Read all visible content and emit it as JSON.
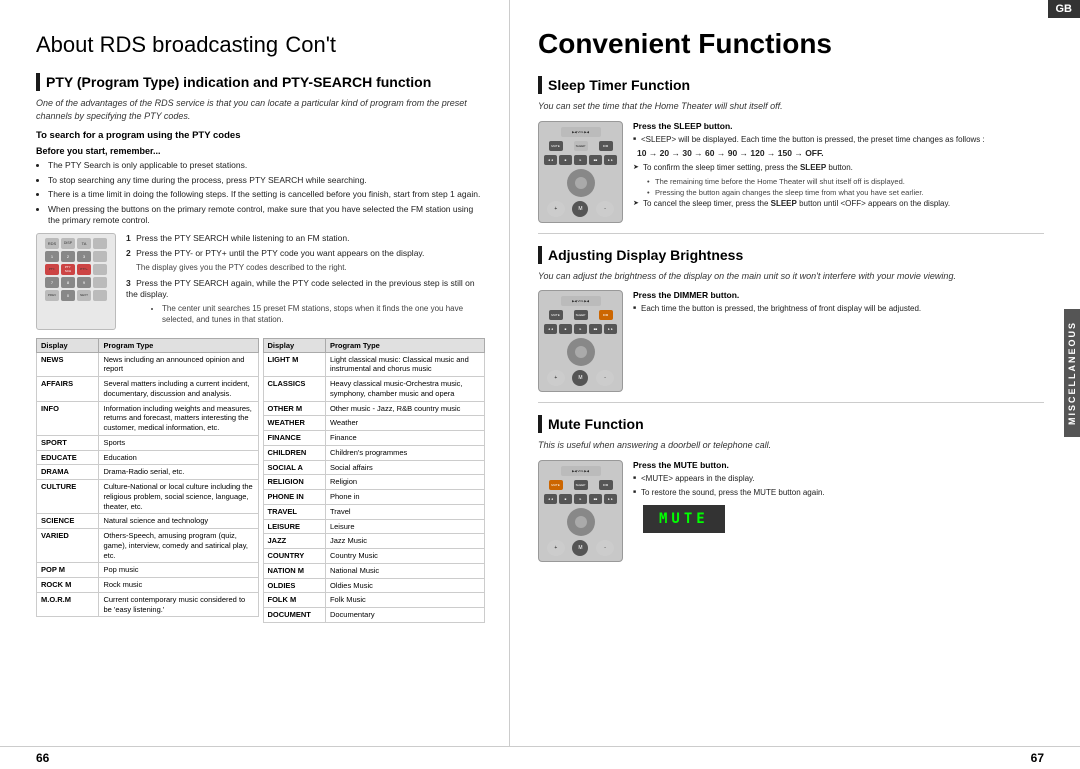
{
  "left": {
    "title": "About RDS broadcasting",
    "title_cont": "Con't",
    "section1_title": "PTY (Program Type) indication and PTY-SEARCH function",
    "intro": "One of the advantages of the RDS service is that you can locate a particular kind of program from the preset channels by specifying the PTY codes.",
    "subheading1": "To search for a program using the PTY codes",
    "subheading2": "Before you start, remember...",
    "bullets": [
      "The PTY Search is only applicable to preset stations.",
      "To stop searching any time during the process, press PTY SEARCH while searching.",
      "There is a time limit in doing the following steps. If the setting is cancelled before you finish, start from step 1 again.",
      "When pressing the buttons on the primary remote control, make sure that you have selected the FM station using the primary remote control."
    ],
    "steps": [
      {
        "num": "1",
        "text": "Press the PTY SEARCH while listening to an FM station."
      },
      {
        "num": "2",
        "text": "Press the PTY- or PTY+ until the PTY code you want appears on the display.",
        "sub": "The display gives you the PTY codes described to the right."
      },
      {
        "num": "3",
        "text": "Press the PTY SEARCH again, while the PTY code selected in the previous step is still on the display.",
        "sub": "The center unit searches 15 preset FM stations, stops when it finds the one you have selected, and tunes in that station."
      }
    ],
    "table_headers": [
      "Display",
      "Program Type",
      "Display",
      "Program Type"
    ],
    "table_rows_left": [
      [
        "NEWS",
        "News including an announced opinion and report"
      ],
      [
        "AFFAIRS",
        "Several matters including a current incident, documentary, discussion and analysis."
      ],
      [
        "INFO",
        "Information including weights and measures, returns and forecast, matters interesting the customer, medical information, etc."
      ],
      [
        "SPORT",
        "Sports"
      ],
      [
        "EDUCATE",
        "Education"
      ],
      [
        "DRAMA",
        "Drama-Radio serial, etc."
      ],
      [
        "CULTURE",
        "Culture-National or local culture including the religious problem, social science, language, theater, etc."
      ],
      [
        "SCIENCE",
        "Natural science and technology"
      ],
      [
        "VARIED",
        "Others-Speech, amusing program (quiz, game), interview, comedy and satirical play, etc."
      ],
      [
        "POP M",
        "Pop music"
      ],
      [
        "ROCK M",
        "Rock music"
      ],
      [
        "M.O.R.M",
        "Current contemporary music considered to be 'easy listening.'"
      ]
    ],
    "table_rows_right": [
      [
        "LIGHT M",
        "Light classical music: Classical music and instrumental and chorus music"
      ],
      [
        "CLASSICS",
        "Heavy classical music-Orchestra music, symphony, chamber music and opera"
      ],
      [
        "OTHER M",
        "Other music - Jazz, R&B country music"
      ],
      [
        "WEATHER",
        "Weather"
      ],
      [
        "FINANCE",
        "Finance"
      ],
      [
        "CHILDREN",
        "Children's programmes"
      ],
      [
        "SOCIAL A",
        "Social affairs"
      ],
      [
        "RELIGION",
        "Religion"
      ],
      [
        "PHONE IN",
        "Phone in"
      ],
      [
        "TRAVEL",
        "Travel"
      ],
      [
        "LEISURE",
        "Leisure"
      ],
      [
        "JAZZ",
        "Jazz Music"
      ],
      [
        "COUNTRY",
        "Country Music"
      ],
      [
        "NATION M",
        "National Music"
      ],
      [
        "OLDIES",
        "Oldies Music"
      ],
      [
        "FOLK M",
        "Folk Music"
      ],
      [
        "DOCUMENT",
        "Documentary"
      ]
    ],
    "page_num": "66"
  },
  "right": {
    "title": "Convenient Functions",
    "gb_badge": "GB",
    "section1_title": "Sleep Timer Function",
    "section1_intro": "You can set the time that the Home Theater will shut itself off.",
    "sleep_press": "Press the SLEEP button.",
    "sleep_bullets": [
      "<SLEEP> will be displayed. Each time the button is pressed, the preset time changes as follows :",
      "10 → 20 → 30 → 60 → 90 → 120 → 150 → OFF."
    ],
    "sleep_confirm": "To confirm the sleep timer setting, press the SLEEP button.",
    "sleep_confirm_subs": [
      "The remaining time before the Home Theater will shut itself off is displayed.",
      "Pressing the button again changes the sleep time from what you have set earlier."
    ],
    "sleep_cancel": "To cancel the sleep timer, press the SLEEP button until <OFF> appears on the display.",
    "section2_title": "Adjusting Display Brightness",
    "section2_intro": "You can adjust the brightness of the display on the main unit so it won't interfere with your movie viewing.",
    "dimmer_press": "Press the DIMMER button.",
    "dimmer_bullet": "Each time the button is pressed, the brightness of front display will be adjusted.",
    "section3_title": "Mute Function",
    "section3_intro": "This is useful when answering a doorbell or telephone call.",
    "mute_press": "Press the MUTE button.",
    "mute_bullets": [
      "<MUTE> appears in the display.",
      "To restore the sound, press the MUTE button again."
    ],
    "mute_display": "MUTE",
    "misc_label": "MISCELLANEOUS",
    "page_num": "67"
  }
}
